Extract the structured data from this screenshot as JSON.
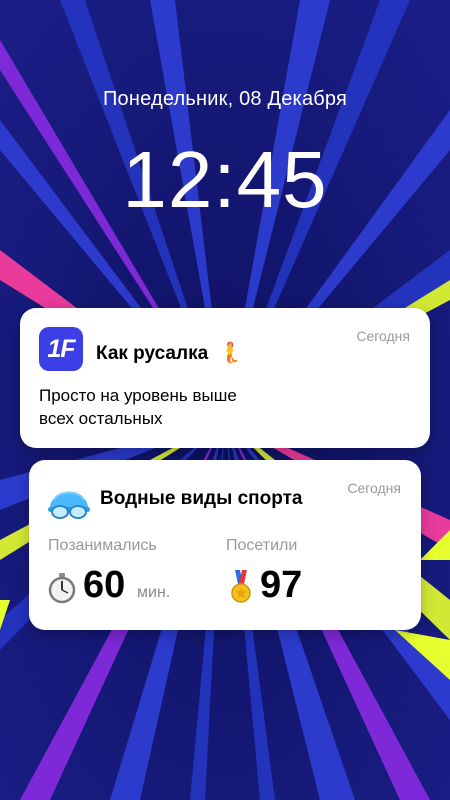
{
  "lockscreen": {
    "date": "Понедельник, 08 Декабря",
    "time": "12:45"
  },
  "notification1": {
    "app_icon_text": "1F",
    "title": "Как русалка",
    "title_emoji": "🧜",
    "time": "Сегодня",
    "body_line1": "Просто на уровень выше",
    "body_line2": "всех остальных"
  },
  "notification2": {
    "title": "Водные виды спорта",
    "time": "Сегодня",
    "stat1": {
      "label": "Позанимались",
      "value": "60",
      "unit": "мин.",
      "icon": "stopwatch-icon"
    },
    "stat2": {
      "label": "Посетили",
      "value": "97",
      "icon": "medal-icon"
    }
  },
  "colors": {
    "background": "#1c1f7a",
    "app_icon": "#3b3fe5",
    "ray_blue": "#2f3fd6",
    "ray_purple": "#8a2be2",
    "ray_yellow": "#e6ff2e",
    "ray_pink": "#ff3fa0"
  }
}
